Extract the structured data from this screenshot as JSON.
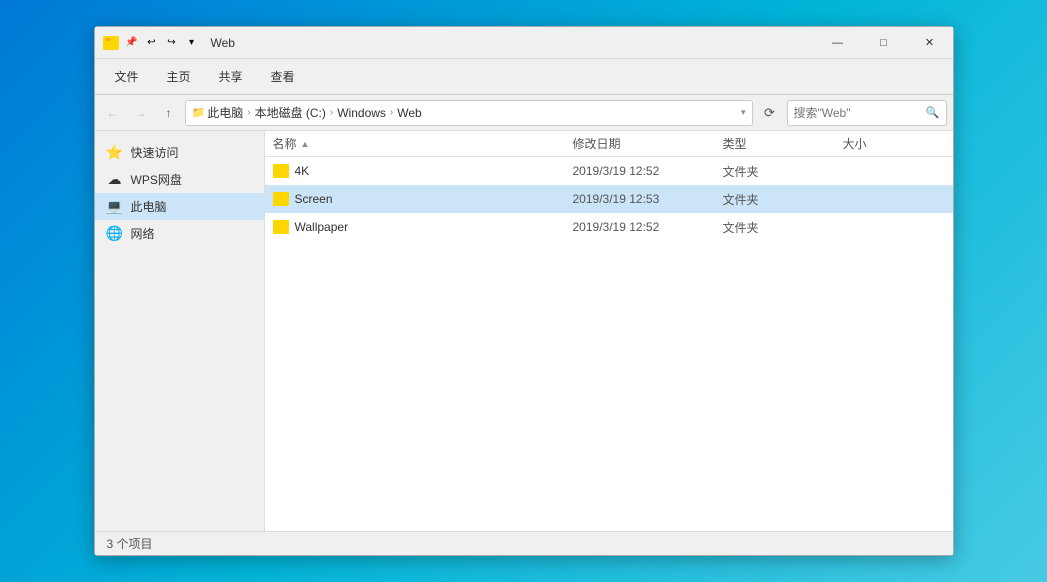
{
  "window": {
    "title": "Web",
    "controls": {
      "minimize": "—",
      "maximize": "□",
      "close": "✕"
    }
  },
  "ribbon": {
    "tabs": [
      {
        "id": "file",
        "label": "文件",
        "active": false
      },
      {
        "id": "home",
        "label": "主页",
        "active": false
      },
      {
        "id": "share",
        "label": "共享",
        "active": false
      },
      {
        "id": "view",
        "label": "查看",
        "active": false
      }
    ]
  },
  "toolbar": {
    "breadcrumb": [
      {
        "label": "此电脑"
      },
      {
        "label": "本地磁盘 (C:)"
      },
      {
        "label": "Windows"
      },
      {
        "label": "Web"
      }
    ],
    "search_placeholder": "搜索\"Web\""
  },
  "sidebar": {
    "items": [
      {
        "id": "quick-access",
        "label": "快速访问",
        "icon": "⭐",
        "selected": false
      },
      {
        "id": "wps-cloud",
        "label": "WPS网盘",
        "icon": "☁",
        "selected": false
      },
      {
        "id": "this-pc",
        "label": "此电脑",
        "icon": "💻",
        "selected": true
      },
      {
        "id": "network",
        "label": "网络",
        "icon": "🌐",
        "selected": false
      }
    ]
  },
  "columns": {
    "name": "名称",
    "date": "修改日期",
    "type": "类型",
    "size": "大小"
  },
  "files": [
    {
      "name": "4K",
      "date": "2019/3/19 12:52",
      "type": "文件夹",
      "size": ""
    },
    {
      "name": "Screen",
      "date": "2019/3/19 12:53",
      "type": "文件夹",
      "size": "",
      "selected": true
    },
    {
      "name": "Wallpaper",
      "date": "2019/3/19 12:52",
      "type": "文件夹",
      "size": ""
    }
  ],
  "statusbar": {
    "count": "3 个项目"
  }
}
